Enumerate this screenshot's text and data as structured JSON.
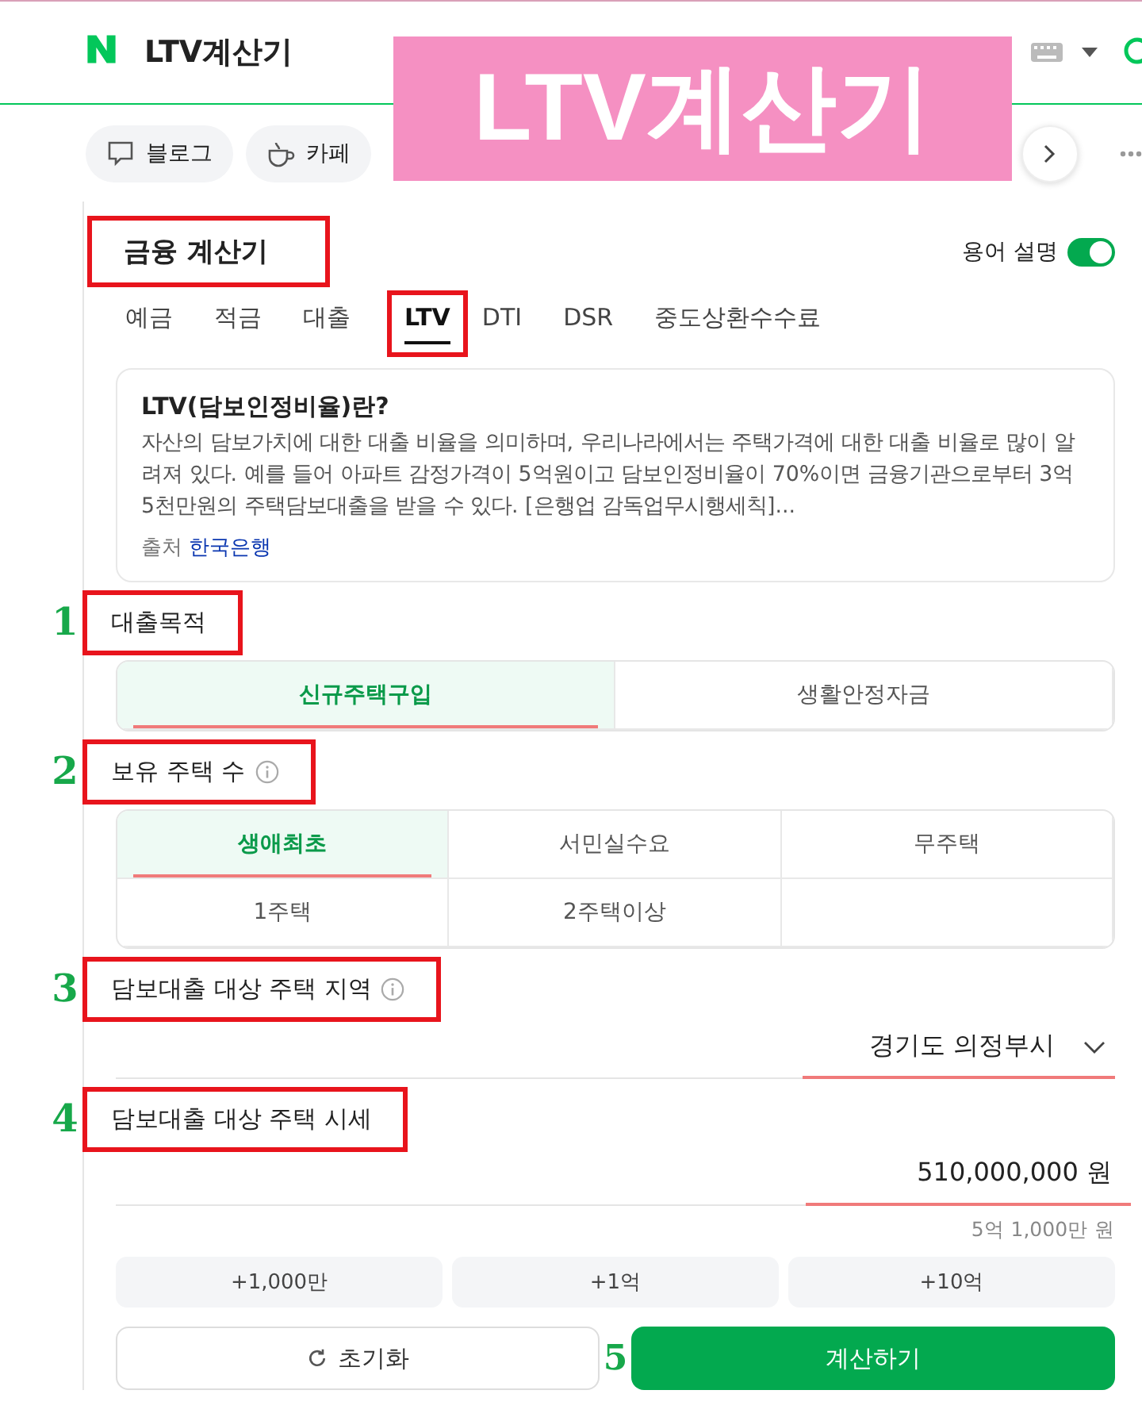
{
  "header": {
    "query": "LTV계산기"
  },
  "search_tabs": [
    {
      "kind": "blog",
      "label": "블로그"
    },
    {
      "kind": "cafe",
      "label": "카페"
    }
  ],
  "overlay_banner": {
    "text": "LTV계산기"
  },
  "calculator": {
    "title": "금융 계산기",
    "glossary_label": "용어 설명",
    "glossary_on": true,
    "tabs": [
      {
        "label": "예금",
        "selected": false
      },
      {
        "label": "적금",
        "selected": false
      },
      {
        "label": "대출",
        "selected": false
      },
      {
        "label": "LTV",
        "selected": true
      },
      {
        "label": "DTI",
        "selected": false
      },
      {
        "label": "DSR",
        "selected": false
      },
      {
        "label": "중도상환수수료",
        "selected": false
      }
    ],
    "info": {
      "title": "LTV(담보인정비율)란?",
      "body": "자산의 담보가치에 대한 대출 비율을 의미하며, 우리나라에서는 주택가격에 대한 대출 비율로 많이 알려져 있다. 예를 들어 아파트 감정가격이 5억원이고 담보인정비율이 70%이면 금융기관으로부터 3억 5천만원의 주택담보대출을 받을 수 있다. [은행업 감독업무시행세칙]...",
      "source_label": "출처",
      "source_link": "한국은행"
    },
    "sections": [
      {
        "kind": "options",
        "marker": "1",
        "label": "대출목적",
        "info_icon": false,
        "options": [
          {
            "label": "신규주택구입",
            "selected": true
          },
          {
            "label": "생활안정자금",
            "selected": false
          }
        ]
      },
      {
        "kind": "options",
        "marker": "2",
        "label": "보유 주택 수",
        "info_icon": true,
        "options": [
          {
            "label": "생애최초",
            "selected": true
          },
          {
            "label": "서민실수요",
            "selected": false
          },
          {
            "label": "무주택",
            "selected": false
          },
          {
            "label": "1주택",
            "selected": false
          },
          {
            "label": "2주택이상",
            "selected": false
          }
        ]
      },
      {
        "kind": "select",
        "marker": "3",
        "label": "담보대출 대상 주택 지역",
        "info_icon": true,
        "value": "경기도 의정부시"
      },
      {
        "kind": "amount",
        "marker": "4",
        "label": "담보대출 대상 주택 시세",
        "info_icon": false,
        "value": "510,000,000",
        "unit": "원",
        "hint": "5억 1,000만 원",
        "quick_buttons": [
          "+1,000만",
          "+1억",
          "+10억"
        ]
      }
    ],
    "reset_button": "초기화",
    "calculate_button": "계산하기",
    "action_marker": "5"
  }
}
